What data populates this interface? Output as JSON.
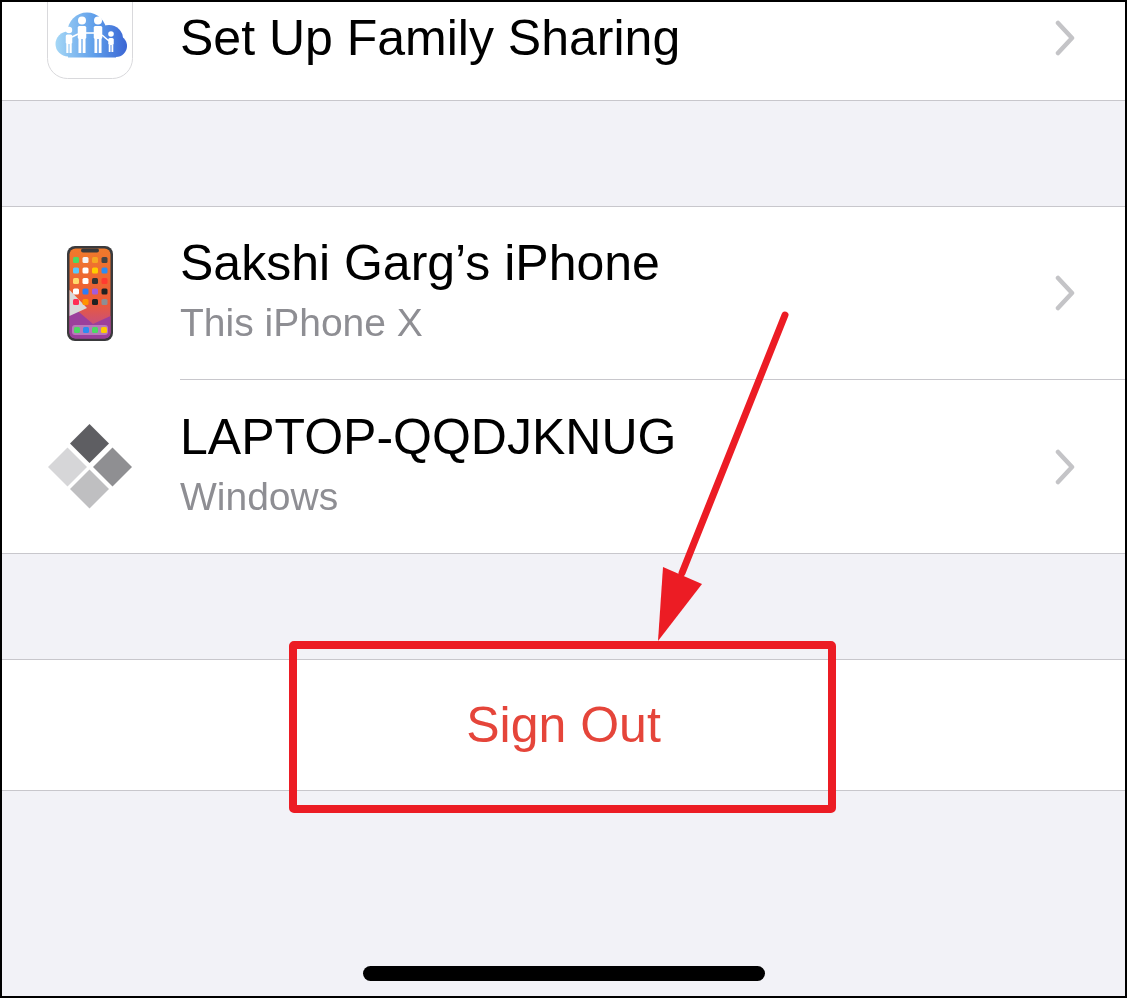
{
  "sections": [
    {
      "kind": "list",
      "rows": [
        {
          "kind": "family",
          "title": "Set Up Family Sharing"
        }
      ]
    },
    {
      "kind": "list",
      "rows": [
        {
          "kind": "phone",
          "title": "Sakshi Garg’s iPhone",
          "subtitle": "This iPhone X"
        },
        {
          "kind": "computer",
          "title": "LAPTOP-QQDJKNUG",
          "subtitle": "Windows"
        }
      ]
    },
    {
      "kind": "action",
      "label": "Sign Out",
      "highlighted": true
    }
  ]
}
